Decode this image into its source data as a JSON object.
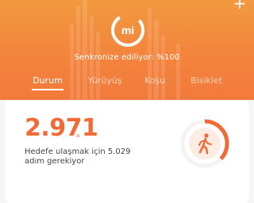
{
  "header": {
    "add_label": "+",
    "logo_text": "mi",
    "sync_status": "Senkronize ediliyor: %100"
  },
  "tabs": [
    {
      "label": "Durum",
      "active": true
    },
    {
      "label": "Yürüyüş",
      "active": false
    },
    {
      "label": "Koşu",
      "active": false
    },
    {
      "label": "Bisiklet",
      "active": false
    }
  ],
  "summary": {
    "steps_value": "2.971",
    "steps_unit": "a",
    "goal_line1": "Hedefe ulaşmak için 5.029",
    "goal_line2": "adım gerekiyor",
    "progress_fraction": 0.37,
    "icon": "walking-person-icon"
  },
  "colors": {
    "accent": "#f26a35",
    "header_top": "#f29a3f",
    "header_bottom": "#f27a3c",
    "ring_track": "#f3f3f3"
  }
}
